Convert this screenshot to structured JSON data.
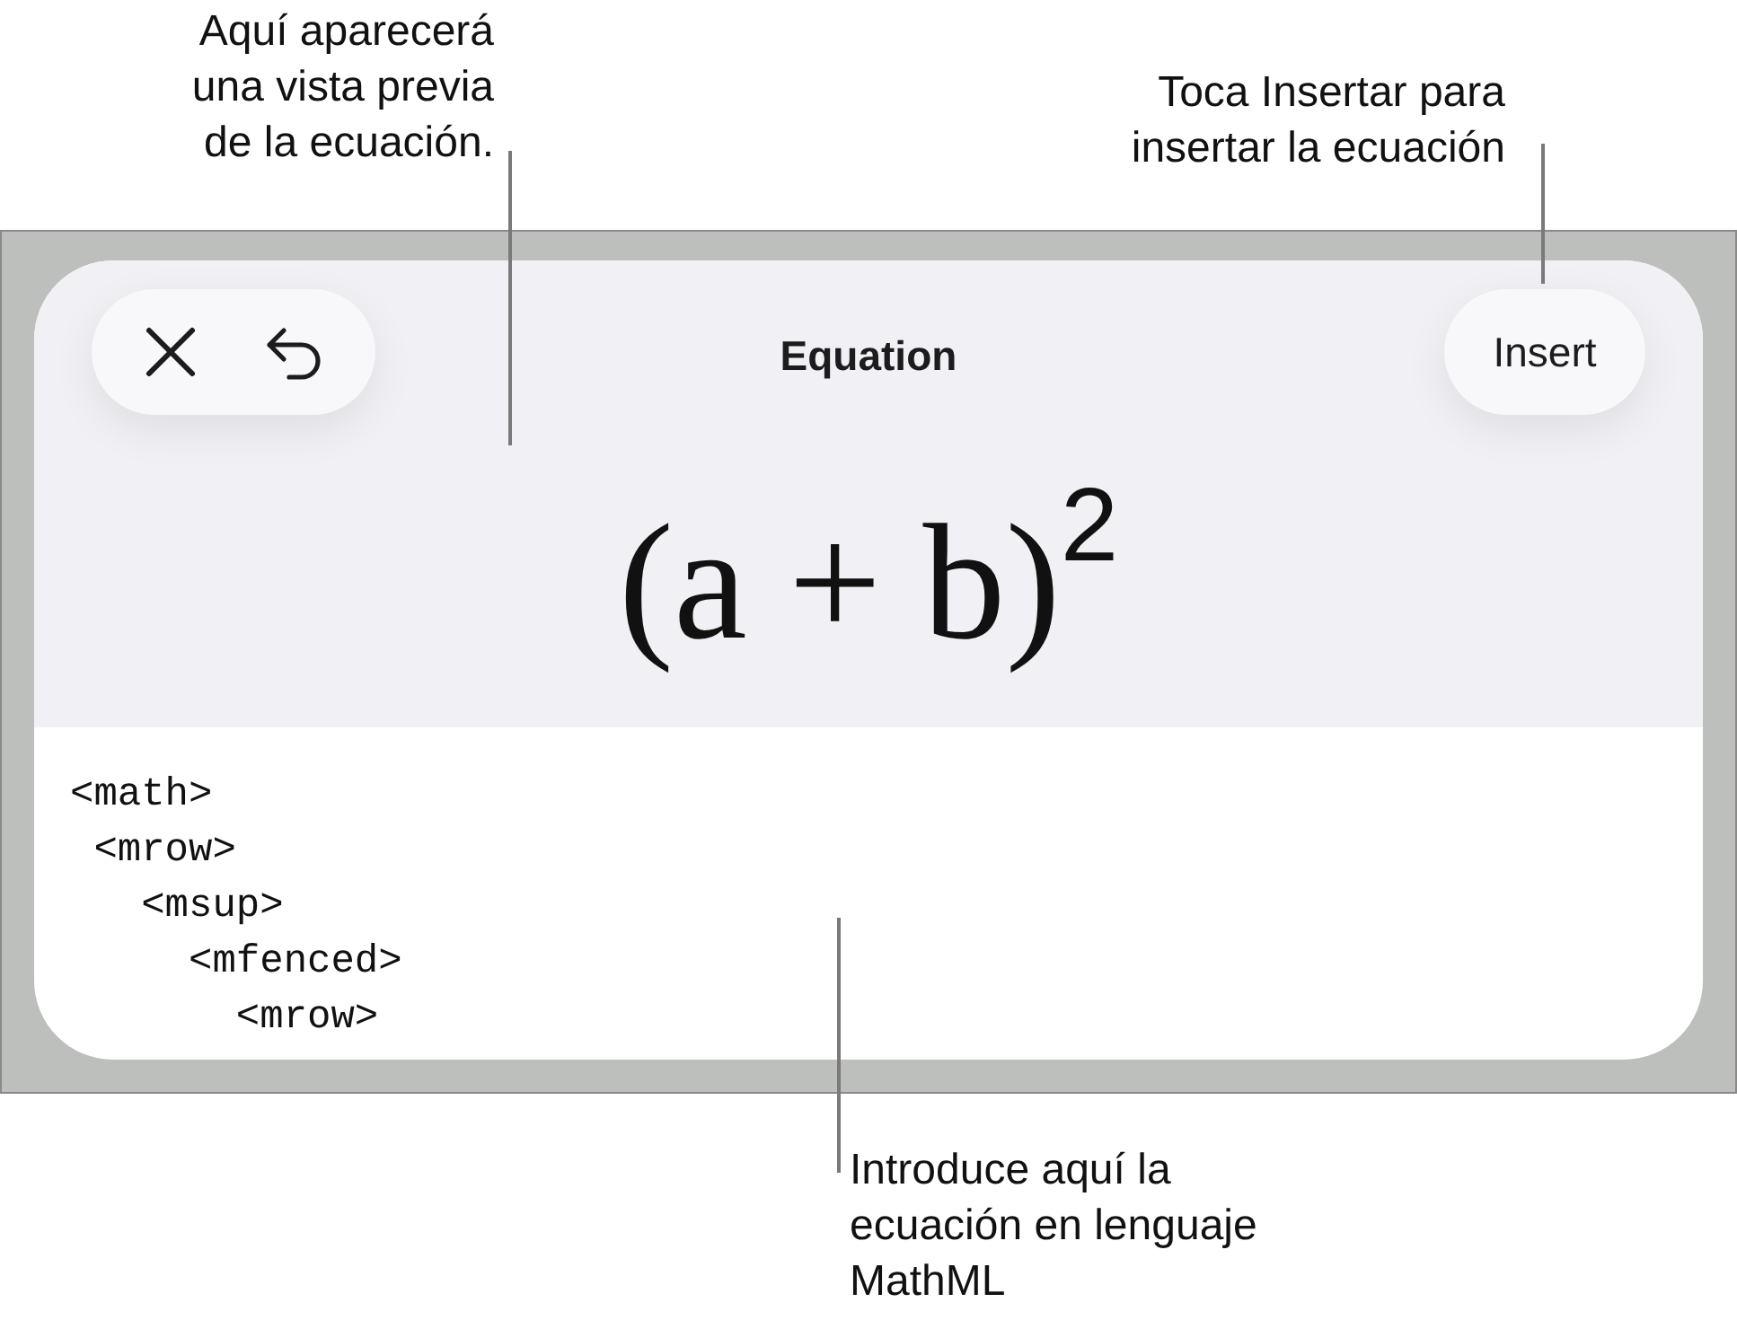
{
  "callouts": [
    {
      "text": "Aquí aparecerá\nuna vista previa\nde la ecuación."
    },
    {
      "text": "Toca Insertar para\ninsertar la ecuación"
    },
    {
      "text": "Introduce aquí la\necuación en lenguaje\nMathML"
    }
  ],
  "sheet": {
    "title": "Equation",
    "insert_button": "Insert",
    "preview": "(a + b)$^{2}$",
    "code_lines": [
      "<math>",
      " <mrow>",
      "   <msup>",
      "     <mfenced>",
      "       <mrow>"
    ]
  }
}
